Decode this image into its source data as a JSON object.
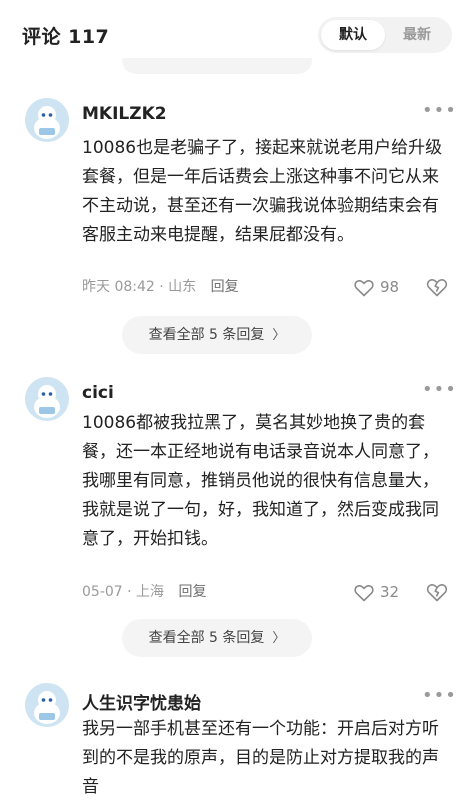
{
  "header": {
    "title": "评论 117",
    "sort_options": [
      "默认",
      "最新"
    ],
    "active_sort": "默认"
  },
  "comments": [
    {
      "username": "MKILZK2",
      "text": "10086也是老骗子了，接起来就说老用户给升级套餐，但是一年后话费会上涨这种事不问它从来不主动说，甚至还有一次骗我说体验期结束会有客服主动来电提醒，结果屁都没有。",
      "time": "昨天 08:42",
      "location": "山东",
      "reply_label": "回复",
      "likes": "98",
      "view_replies": "查看全部 5 条回复"
    },
    {
      "username": "cici",
      "text": "10086都被我拉黑了，莫名其妙地换了贵的套餐，还一本正经地说有电话录音说本人同意了，我哪里有同意，推销员他说的很快有信息量大，我就是说了一句，好，我知道了，然后变成我同意了，开始扣钱。",
      "time": "05-07",
      "location": "上海",
      "reply_label": "回复",
      "likes": "32",
      "view_replies": "查看全部 5 条回复"
    },
    {
      "username": "人生识字忧患始",
      "text": "我另一部手机甚至还有一个功能：开启后对方听到的不是我的原声，目的是防止对方提取我的声音"
    }
  ],
  "icons": {
    "more": "more-dots-icon",
    "like": "heart-outline-icon",
    "dislike": "broken-heart-icon",
    "chevron": "chevron-right-icon"
  },
  "colors": {
    "avatar_bg": "#cfe4f2",
    "muted_text": "#9a9a9a",
    "pill_bg": "#f4f4f4"
  }
}
